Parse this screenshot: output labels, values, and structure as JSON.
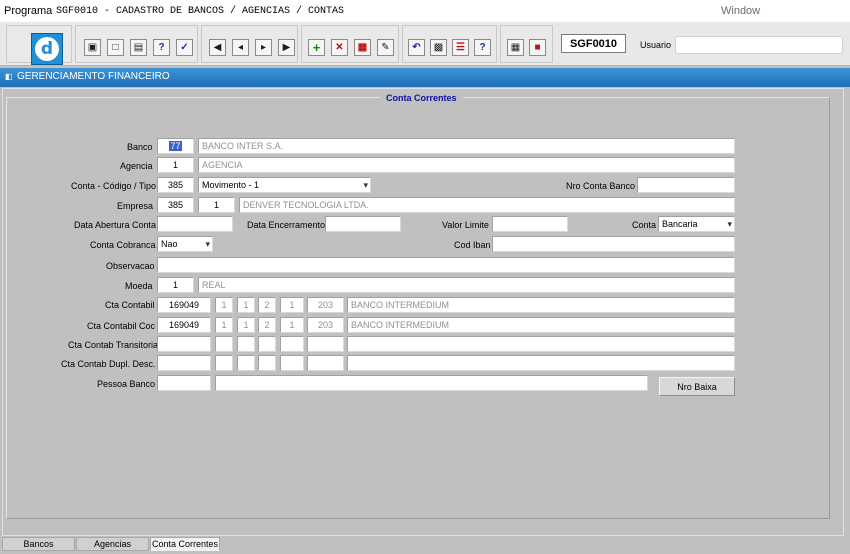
{
  "titlebar": {
    "label": "Programa",
    "program": "SGF0010 - CADASTRO DE BANCOS / AGENCIAS / CONTAS",
    "window_menu": "Window"
  },
  "toolbar": {
    "program_code": "SGF0010",
    "usuario_label": "Usuario",
    "usuario_value": "",
    "logo_letter": "d"
  },
  "window_title": "GERENCIAMENTO FINANCEIRO",
  "form": {
    "frame_title": "Conta Correntes",
    "labels": {
      "banco": "Banco",
      "agencia": "Agencia",
      "conta_codigo_tipo": "Conta - Código / Tipo",
      "nro_conta_banco": "Nro Conta Banco",
      "empresa": "Empresa",
      "data_abertura": "Data Abertura Conta",
      "data_encerramento": "Data Encerramento",
      "valor_limite": "Valor Limite",
      "conta": "Conta",
      "conta_cobranca": "Conta Cobranca",
      "cod_iban": "Cod Iban",
      "observacao": "Observacao",
      "moeda": "Moeda",
      "cta_contabil": "Cta Contabil",
      "cta_contabil_coc": "Cta Contabil Coc",
      "cta_contab_transitoria": "Cta Contab Transitoria",
      "cta_contab_dupl_desc": "Cta Contab Dupl. Desc.",
      "pessoa_banco": "Pessoa Banco"
    },
    "values": {
      "banco_code": "77",
      "banco_name": "BANCO INTER S.A.",
      "agencia_code": "1",
      "agencia_name": "AGENCIA",
      "conta_codigo": "385",
      "conta_tipo": "Movimento - 1",
      "nro_conta_banco": "",
      "empresa_code": "385",
      "empresa_num": "1",
      "empresa_name": "DENVER TECNOLOGIA LTDA.",
      "data_abertura": "",
      "data_encerramento": "",
      "valor_limite": "",
      "conta": "Bancaria",
      "conta_cobranca": "Nao",
      "cod_iban": "",
      "observacao": "",
      "moeda_code": "1",
      "moeda_name": "REAL",
      "cta_contabil": [
        "169049",
        "1",
        "1",
        "2",
        "1",
        "203"
      ],
      "cta_contabil_desc": "BANCO INTERMEDIUM",
      "cta_contabil_coc": [
        "169049",
        "1",
        "1",
        "2",
        "1",
        "203"
      ],
      "cta_contabil_coc_desc": "BANCO INTERMEDIUM",
      "pessoa_banco": "",
      "pessoa_banco_name": ""
    },
    "button_nro_baixa": "Nro Baixa"
  },
  "tabs": [
    {
      "label": "Bancos",
      "active": false
    },
    {
      "label": "Agencias",
      "active": false
    },
    {
      "label": "Conta Correntes",
      "active": true
    }
  ]
}
